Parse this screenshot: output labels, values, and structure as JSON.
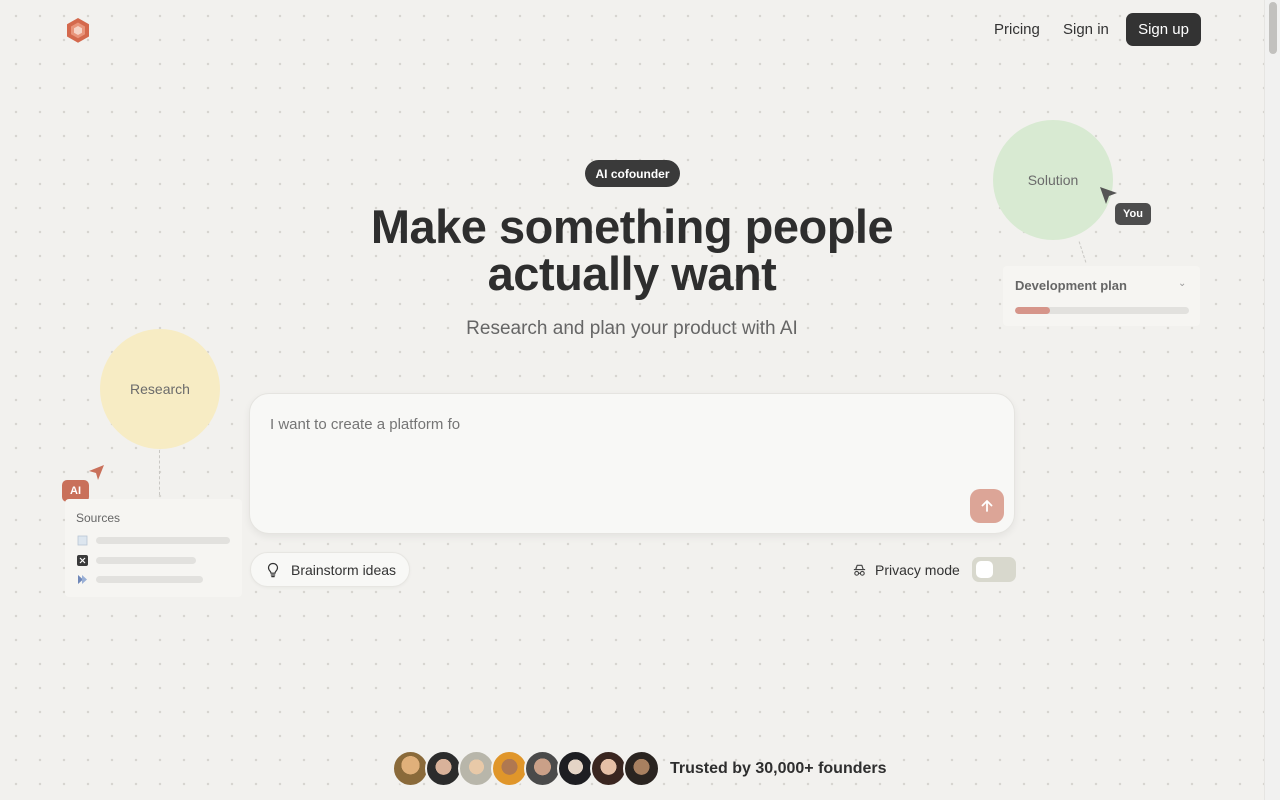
{
  "nav": {
    "pricing_label": "Pricing",
    "signin_label": "Sign in",
    "signup_label": "Sign up"
  },
  "hero": {
    "badge": "AI cofounder",
    "title": "Make something people actually want",
    "subtitle": "Research and plan your product with AI"
  },
  "prompt": {
    "placeholder": "I want to create a platform fo"
  },
  "actions": {
    "brainstorm_label": "Brainstorm ideas",
    "privacy_label": "Privacy mode",
    "privacy_enabled": false
  },
  "illustration": {
    "research_label": "Research",
    "ai_tag": "AI",
    "sources_title": "Sources",
    "solution_label": "Solution",
    "you_tag": "You",
    "devplan_title": "Development plan",
    "devplan_progress": 0.2
  },
  "trust": {
    "text": "Trusted by 30,000+ founders",
    "avatar_count": 8
  },
  "colors": {
    "background": "#f2f1ee",
    "accent": "#c9705a",
    "send_button": "#dca597",
    "dark": "#333333",
    "research_bubble": "#f7ecc4",
    "solution_bubble": "#d8ead2"
  }
}
